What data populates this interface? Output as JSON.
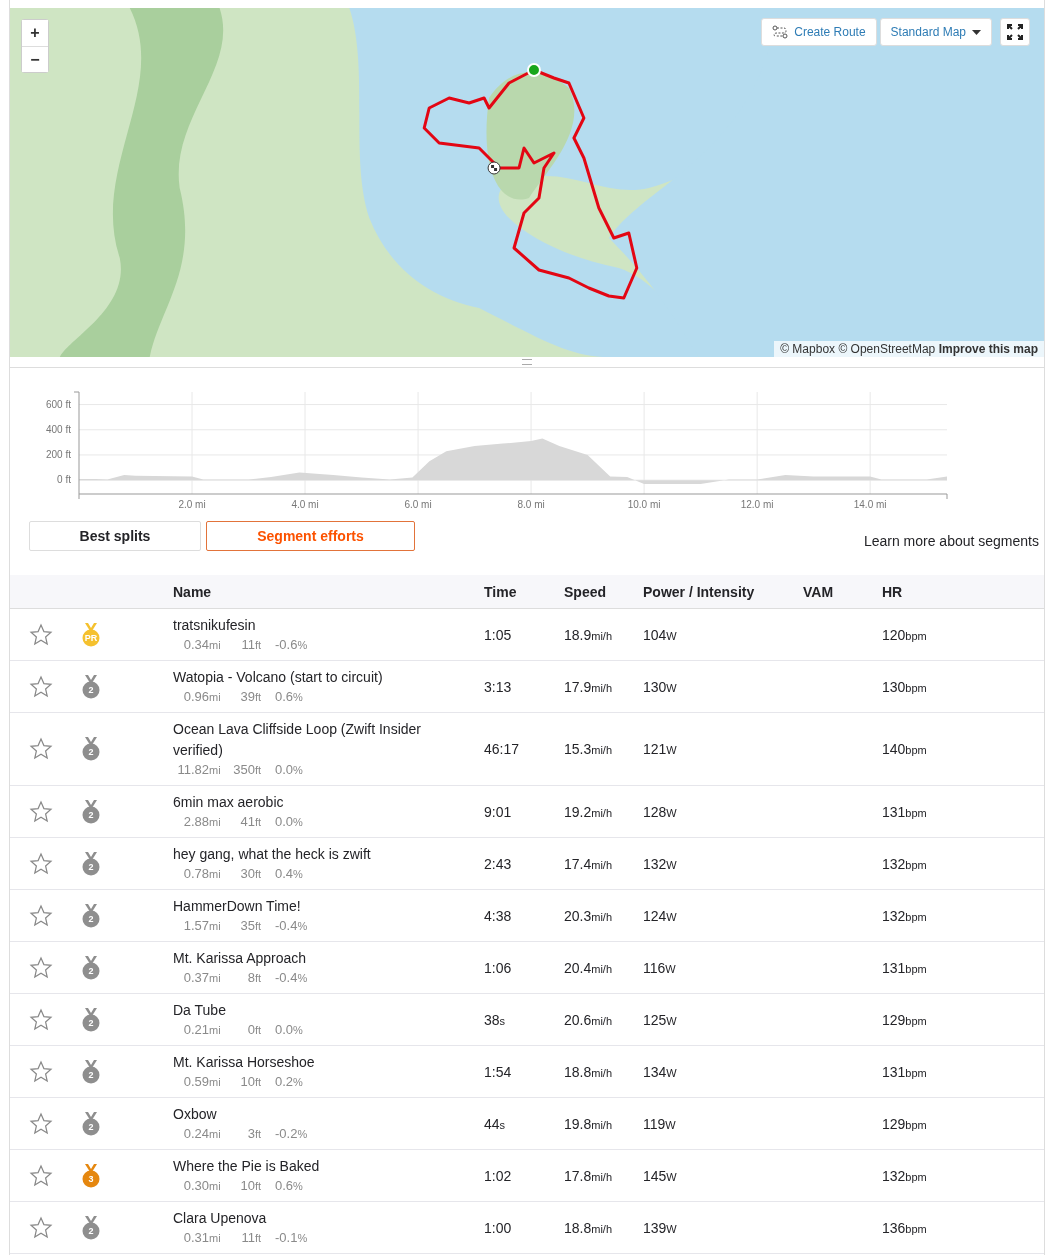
{
  "map": {
    "zoom_in": "+",
    "zoom_out": "−",
    "create_route": "Create Route",
    "map_style": "Standard Map",
    "attribution": [
      {
        "text": "© Mapbox",
        "bold": false
      },
      {
        "text": "© OpenStreetMap",
        "bold": false
      },
      {
        "text": "Improve this map",
        "bold": true
      }
    ]
  },
  "elevation": {
    "chart_data": {
      "type": "area",
      "x": [
        0,
        0.3,
        0.5,
        0.8,
        1.0,
        2.0,
        2.2,
        3.0,
        3.4,
        3.9,
        4.5,
        5.0,
        5.5,
        5.9,
        6.2,
        6.5,
        7.0,
        7.5,
        8.0,
        8.2,
        8.5,
        9.0,
        9.4,
        9.7,
        10.0,
        11.0,
        11.5,
        12.0,
        12.5,
        13.0,
        14.0,
        14.2,
        15.0,
        15.36
      ],
      "grid": true,
      "series": [
        {
          "color": "#d8d8d8",
          "values": [
            10,
            10,
            5,
            40,
            35,
            30,
            5,
            5,
            25,
            60,
            40,
            20,
            5,
            20,
            150,
            230,
            270,
            290,
            310,
            330,
            270,
            200,
            30,
            25,
            -30,
            -30,
            5,
            5,
            40,
            30,
            30,
            5,
            5,
            30
          ]
        }
      ],
      "xlim": [
        0,
        15.36
      ],
      "ylim": [
        -110,
        700
      ],
      "xticks": [
        {
          "value": 2,
          "label": "2.0 mi"
        },
        {
          "value": 4,
          "label": "4.0 mi"
        },
        {
          "value": 6,
          "label": "6.0 mi"
        },
        {
          "value": 8,
          "label": "8.0 mi"
        },
        {
          "value": 10,
          "label": "10.0 mi"
        },
        {
          "value": 12,
          "label": "12.0 mi"
        },
        {
          "value": 14,
          "label": "14.0 mi"
        }
      ],
      "yticks": [
        {
          "value": 0,
          "label": "0 ft"
        },
        {
          "value": 200,
          "label": "200 ft"
        },
        {
          "value": 400,
          "label": "400 ft"
        },
        {
          "value": 600,
          "label": "600 ft"
        }
      ]
    }
  },
  "tabs": [
    {
      "label": "Best splits",
      "selected": false
    },
    {
      "label": "Segment efforts",
      "selected": true
    }
  ],
  "learn_more": "Learn more about segments",
  "table": {
    "columns": [
      "Name",
      "Time",
      "Speed",
      "Power / Intensity",
      "VAM",
      "HR"
    ],
    "rows": [
      {
        "starred": false,
        "medal": {
          "kind": "gold",
          "label": "PR"
        },
        "name": "tratsnikufesin",
        "distance": "0.34",
        "distance_unit": "mi",
        "elev": "11",
        "elev_unit": "ft",
        "grade": "-0.6",
        "grade_unit": "%",
        "time": "1:05",
        "speed": "18.9",
        "speed_unit": "mi/h",
        "power": "104",
        "power_unit": "W",
        "hr": "120",
        "hr_unit": "bpm"
      },
      {
        "starred": false,
        "medal": {
          "kind": "silver",
          "label": "2"
        },
        "name": "Watopia - Volcano (start to circuit)",
        "distance": "0.96",
        "distance_unit": "mi",
        "elev": "39",
        "elev_unit": "ft",
        "grade": "0.6",
        "grade_unit": "%",
        "time": "3:13",
        "speed": "17.9",
        "speed_unit": "mi/h",
        "power": "130",
        "power_unit": "W",
        "hr": "130",
        "hr_unit": "bpm"
      },
      {
        "starred": false,
        "medal": {
          "kind": "silver",
          "label": "2"
        },
        "name": "Ocean Lava Cliffside Loop (Zwift Insider verified)",
        "distance": "11.82",
        "distance_unit": "mi",
        "elev": "350",
        "elev_unit": "ft",
        "grade": "0.0",
        "grade_unit": "%",
        "time": "46:17",
        "speed": "15.3",
        "speed_unit": "mi/h",
        "power": "121",
        "power_unit": "W",
        "hr": "140",
        "hr_unit": "bpm"
      },
      {
        "starred": false,
        "medal": {
          "kind": "silver",
          "label": "2"
        },
        "name": "6min max aerobic",
        "distance": "2.88",
        "distance_unit": "mi",
        "elev": "41",
        "elev_unit": "ft",
        "grade": "0.0",
        "grade_unit": "%",
        "time": "9:01",
        "speed": "19.2",
        "speed_unit": "mi/h",
        "power": "128",
        "power_unit": "W",
        "hr": "131",
        "hr_unit": "bpm"
      },
      {
        "starred": false,
        "medal": {
          "kind": "silver",
          "label": "2"
        },
        "name": "hey gang, what the heck is zwift",
        "distance": "0.78",
        "distance_unit": "mi",
        "elev": "30",
        "elev_unit": "ft",
        "grade": "0.4",
        "grade_unit": "%",
        "time": "2:43",
        "speed": "17.4",
        "speed_unit": "mi/h",
        "power": "132",
        "power_unit": "W",
        "hr": "132",
        "hr_unit": "bpm"
      },
      {
        "starred": false,
        "medal": {
          "kind": "silver",
          "label": "2"
        },
        "name": "HammerDown Time!",
        "distance": "1.57",
        "distance_unit": "mi",
        "elev": "35",
        "elev_unit": "ft",
        "grade": "-0.4",
        "grade_unit": "%",
        "time": "4:38",
        "speed": "20.3",
        "speed_unit": "mi/h",
        "power": "124",
        "power_unit": "W",
        "hr": "132",
        "hr_unit": "bpm"
      },
      {
        "starred": false,
        "medal": {
          "kind": "silver",
          "label": "2"
        },
        "name": "Mt. Karissa Approach",
        "distance": "0.37",
        "distance_unit": "mi",
        "elev": "8",
        "elev_unit": "ft",
        "grade": "-0.4",
        "grade_unit": "%",
        "time": "1:06",
        "speed": "20.4",
        "speed_unit": "mi/h",
        "power": "116",
        "power_unit": "W",
        "hr": "131",
        "hr_unit": "bpm"
      },
      {
        "starred": false,
        "medal": {
          "kind": "silver",
          "label": "2"
        },
        "name": "Da Tube",
        "distance": "0.21",
        "distance_unit": "mi",
        "elev": "0",
        "elev_unit": "ft",
        "grade": "0.0",
        "grade_unit": "%",
        "time": "38",
        "time_unit": "s",
        "speed": "20.6",
        "speed_unit": "mi/h",
        "power": "125",
        "power_unit": "W",
        "hr": "129",
        "hr_unit": "bpm"
      },
      {
        "starred": false,
        "medal": {
          "kind": "silver",
          "label": "2"
        },
        "name": "Mt. Karissa Horseshoe",
        "distance": "0.59",
        "distance_unit": "mi",
        "elev": "10",
        "elev_unit": "ft",
        "grade": "0.2",
        "grade_unit": "%",
        "time": "1:54",
        "speed": "18.8",
        "speed_unit": "mi/h",
        "power": "134",
        "power_unit": "W",
        "hr": "131",
        "hr_unit": "bpm"
      },
      {
        "starred": false,
        "medal": {
          "kind": "silver",
          "label": "2"
        },
        "name": "Oxbow",
        "distance": "0.24",
        "distance_unit": "mi",
        "elev": "3",
        "elev_unit": "ft",
        "grade": "-0.2",
        "grade_unit": "%",
        "time": "44",
        "time_unit": "s",
        "speed": "19.8",
        "speed_unit": "mi/h",
        "power": "119",
        "power_unit": "W",
        "hr": "129",
        "hr_unit": "bpm"
      },
      {
        "starred": false,
        "medal": {
          "kind": "bronze",
          "label": "3"
        },
        "name": "Where the Pie is Baked",
        "distance": "0.30",
        "distance_unit": "mi",
        "elev": "10",
        "elev_unit": "ft",
        "grade": "0.6",
        "grade_unit": "%",
        "time": "1:02",
        "speed": "17.8",
        "speed_unit": "mi/h",
        "power": "145",
        "power_unit": "W",
        "hr": "132",
        "hr_unit": "bpm"
      },
      {
        "starred": false,
        "medal": {
          "kind": "silver",
          "label": "2"
        },
        "name": "Clara Upenova",
        "distance": "0.31",
        "distance_unit": "mi",
        "elev": "11",
        "elev_unit": "ft",
        "grade": "-0.1",
        "grade_unit": "%",
        "time": "1:00",
        "speed": "18.8",
        "speed_unit": "mi/h",
        "power": "139",
        "power_unit": "W",
        "hr": "136",
        "hr_unit": "bpm"
      }
    ]
  }
}
